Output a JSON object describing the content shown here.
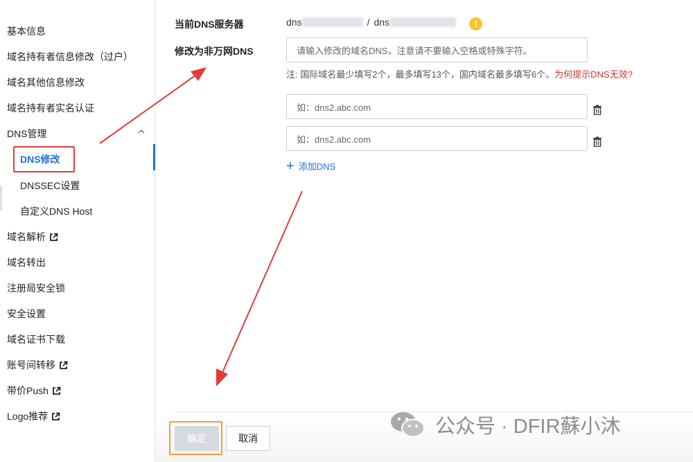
{
  "sidebar": {
    "items": [
      {
        "label": "基本信息"
      },
      {
        "label": "域名持有者信息修改（过户）"
      },
      {
        "label": "域名其他信息修改"
      },
      {
        "label": "域名持有者实名认证"
      },
      {
        "label": "DNS管理"
      },
      {
        "label": "DNS修改"
      },
      {
        "label": "DNSSEC设置"
      },
      {
        "label": "自定义DNS Host"
      },
      {
        "label": "域名解析"
      },
      {
        "label": "域名转出"
      },
      {
        "label": "注册局安全锁"
      },
      {
        "label": "安全设置"
      },
      {
        "label": "域名证书下载"
      },
      {
        "label": "账号间转移"
      },
      {
        "label": "带价Push"
      },
      {
        "label": "Logo推荐"
      }
    ]
  },
  "main": {
    "current_dns_label": "当前DNS服务器",
    "current_dns_prefix1": "dns",
    "current_dns_sep": "/",
    "current_dns_prefix2": "dns",
    "modify_label": "修改为非万网DNS",
    "main_input_placeholder": "请输入修改的域名DNS，注意请不要输入空格或特殊字符。",
    "note_text": "注:   国际域名最少填写2个，最多填写13个，国内域名最多填写6个。",
    "note_link": "为何提示DNS无效?",
    "dns_inputs": [
      {
        "placeholder": "如：dns2.abc.com"
      },
      {
        "placeholder": "如：dns2.abc.com"
      }
    ],
    "add_dns_label": "添加DNS"
  },
  "footer": {
    "confirm_label": "确定",
    "cancel_label": "取消"
  },
  "watermark": {
    "text": "公众号 · DFIR蘇小沐"
  },
  "colors": {
    "accent": "#1f6fd6",
    "annotation_red": "#e23b3b",
    "annotation_orange": "#f39c38",
    "warning": "#f5c531",
    "link_red": "#c8372d"
  }
}
